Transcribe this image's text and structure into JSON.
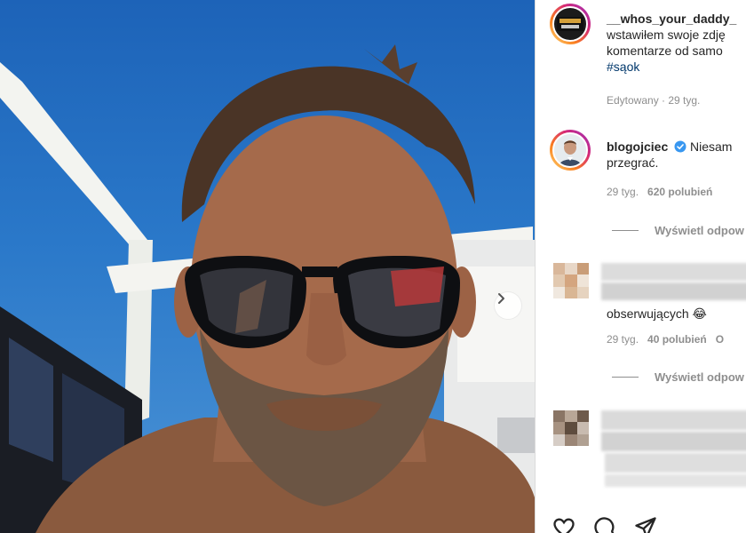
{
  "photo": {
    "next_label": "Następne zdjęcie"
  },
  "post": {
    "username": "__whos_your_daddy_",
    "caption_line1": "wstawiłem swoje zdję",
    "caption_line2": "komentarze od samo",
    "hashtag": "#sąok",
    "edited": "Edytowany · 29 tyg."
  },
  "comments": [
    {
      "username": "blogojciec",
      "verified": true,
      "text_line1": "Niesam",
      "text_line2": "przegrać.",
      "age": "29 tyg.",
      "likes": "620 polubień",
      "view_replies": "Wyświetl odpow"
    },
    {
      "username": "",
      "text_line2": "obserwujących 😂",
      "age": "29 tyg.",
      "likes": "40 polubień",
      "extra": "O",
      "view_replies": "Wyświetl odpow"
    }
  ],
  "colors": {
    "sky": "#2a78c9",
    "link": "#00376b",
    "verified": "#3897f0",
    "muted": "#8e8e8e"
  },
  "icons": [
    "chevron-right-icon",
    "verified-badge-icon",
    "heart-icon",
    "comment-icon",
    "share-icon"
  ]
}
